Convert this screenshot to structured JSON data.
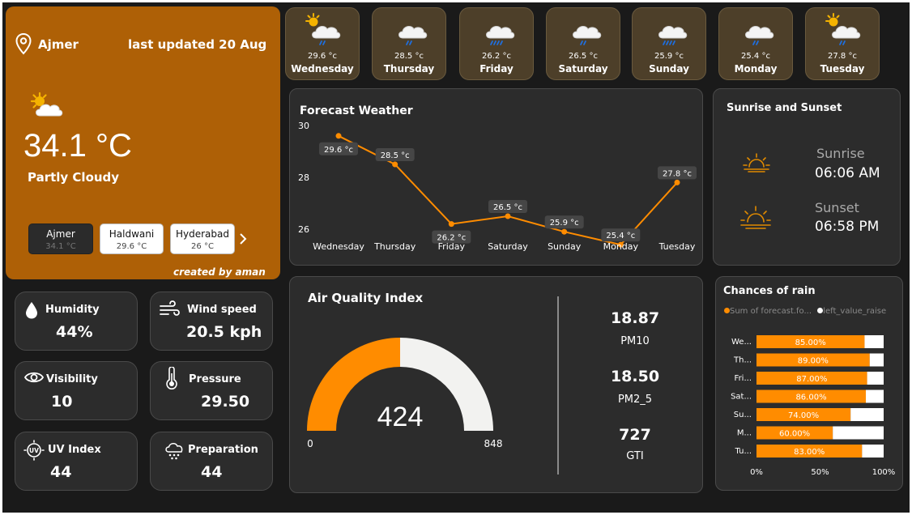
{
  "current": {
    "city": "Ajmer",
    "last_updated": "last updated 20 Aug",
    "temperature": "34.1 °C",
    "condition": "Partly Cloudy",
    "credit": "created by aman",
    "icon": "partly-cloudy-sun-icon"
  },
  "cities": [
    {
      "name": "Ajmer",
      "temp": "34.1 °C",
      "selected": true
    },
    {
      "name": "Haldwani",
      "temp": "29.6 °C",
      "selected": false
    },
    {
      "name": "Hyderabad",
      "temp": "26 °C",
      "selected": false
    }
  ],
  "forecast_tiles": [
    {
      "day": "Wednesday",
      "temp": "29.6 °c",
      "icon": "sun-cloud-rain-icon"
    },
    {
      "day": "Thursday",
      "temp": "28.5 °c",
      "icon": "cloud-rain-icon"
    },
    {
      "day": "Friday",
      "temp": "26.2 °c",
      "icon": "cloud-heavy-rain-icon"
    },
    {
      "day": "Saturday",
      "temp": "26.5 °c",
      "icon": "cloud-rain-icon"
    },
    {
      "day": "Sunday",
      "temp": "25.9 °c",
      "icon": "cloud-heavy-rain-icon"
    },
    {
      "day": "Monday",
      "temp": "25.4 °c",
      "icon": "cloud-rain-icon"
    },
    {
      "day": "Tuesday",
      "temp": "27.8 °c",
      "icon": "sun-cloud-rain-icon"
    }
  ],
  "forecast_chart": {
    "title": "Forecast Weather"
  },
  "chart_data": [
    {
      "type": "line",
      "title": "Forecast Weather",
      "categories": [
        "Wednesday",
        "Thursday",
        "Friday",
        "Saturday",
        "Sunday",
        "Monday",
        "Tuesday"
      ],
      "values": [
        29.6,
        28.5,
        26.2,
        26.5,
        25.9,
        25.4,
        27.8
      ],
      "data_labels": [
        "29.6 °c",
        "28.5 °c",
        "26.2 °c",
        "26.5 °c",
        "25.9 °c",
        "25.4 °c",
        "27.8 °c"
      ],
      "yticks": [
        "30",
        "28",
        "26"
      ],
      "ylim": [
        25,
        30
      ],
      "color": "#ff8c00",
      "grid": false
    },
    {
      "type": "bar",
      "title": "Chances of rain",
      "orientation": "horizontal",
      "stacked": true,
      "categories": [
        "We...",
        "Th...",
        "Fri...",
        "Sat...",
        "Su...",
        "M...",
        "Tu..."
      ],
      "series": [
        {
          "name": "Sum of forecast.fo...",
          "values": [
            85,
            89,
            87,
            86,
            74,
            60,
            83
          ],
          "color": "#ff8c00"
        },
        {
          "name": "left_value_raise",
          "values": [
            15,
            11,
            13,
            14,
            26,
            40,
            17
          ],
          "color": "#ffffff"
        }
      ],
      "data_labels": [
        "85.00%",
        "89.00%",
        "87.00%",
        "86.00%",
        "74.00%",
        "60.00%",
        "83.00%"
      ],
      "xticks": [
        "0%",
        "50%",
        "100%"
      ],
      "xlim": [
        0,
        100
      ],
      "legend": "top"
    },
    {
      "type": "gauge",
      "title": "Air Quality Index",
      "value": 424,
      "min": 0,
      "max": 848,
      "value_label": "424",
      "min_label": "0",
      "max_label": "848",
      "colors": {
        "fill": "#ff8c00",
        "track": "#f2f2f0"
      }
    }
  ],
  "sun": {
    "title": "Sunrise and Sunset",
    "sunrise_label": "Sunrise",
    "sunrise_time": "06:06 AM",
    "sunset_label": "Sunset",
    "sunset_time": "06:58 PM"
  },
  "rain": {
    "title": "Chances of rain",
    "legend1": "Sum of forecast.fo...",
    "legend2": "left_value_raise"
  },
  "aqi": {
    "title": "Air Quality Index",
    "pm10_value": "18.87",
    "pm10_label": "PM10",
    "pm25_value": "18.50",
    "pm25_label": "PM2_5",
    "gti_value": "727",
    "gti_label": "GTI"
  },
  "stats": {
    "humidity": {
      "label": "Humidity",
      "value": "44%"
    },
    "wind": {
      "label": "Wind speed",
      "value": "20.5 kph"
    },
    "visibility": {
      "label": "Visibility",
      "value": "10"
    },
    "pressure": {
      "label": "Pressure",
      "value": "29.50"
    },
    "uv": {
      "label": "UV Index",
      "value": "44"
    },
    "precipitation": {
      "label": "Preparation",
      "value": "44"
    }
  },
  "colors": {
    "accent": "#ff8c00",
    "main_card": "#ae6006",
    "tile": "#4d3f29",
    "panel": "#2c2c2c",
    "background": "#1a1a1a"
  }
}
